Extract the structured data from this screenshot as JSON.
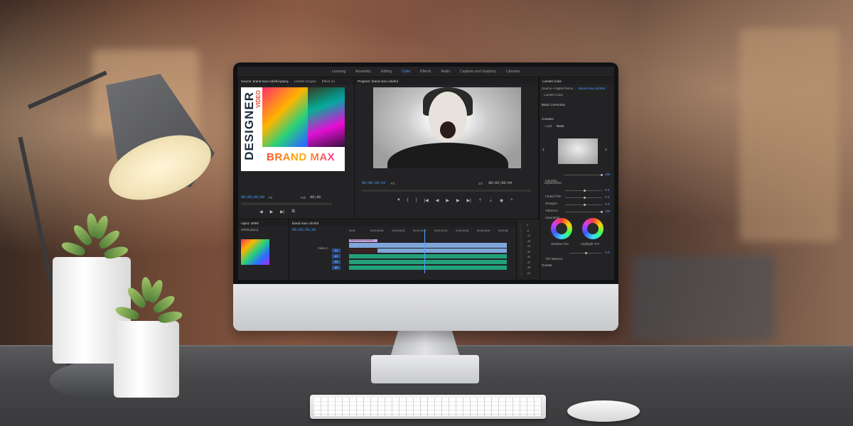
{
  "workspace_tabs": [
    "Learning",
    "Assembly",
    "Editing",
    "Color",
    "Effects",
    "Audio",
    "Captions and Graphics",
    "Libraries"
  ],
  "active_workspace": "Color",
  "source_panel": {
    "tabs": [
      "Source: brand max colorful.prproj",
      "Lumetri Scopes",
      "Effect Co"
    ],
    "poster": {
      "side_text": "DESIGNER",
      "side_small": "VIDEO",
      "title": "BRAND MAX"
    },
    "timecode": "00;00;00;00",
    "fit": "Fit",
    "quality": "Full",
    "timecode_right": "00;00"
  },
  "program_panel": {
    "title": "Program: brand max colorful",
    "timecode": "00;00;28;19",
    "fit": "Fit",
    "scale": "1/2",
    "duration": "00;02;56;04"
  },
  "project_panel": {
    "tabs": [
      "roject: 4efe8",
      "brand max colorful"
    ],
    "file": "4efe8.prproj"
  },
  "timeline": {
    "timecode": "00;00;28;19",
    "ruler": [
      "00;00",
      "00;00;08;00",
      "00;00;16;00",
      "00;00;24;00",
      "00;00;32;00",
      "00;00;40;00",
      "00;00;48;00",
      "00;00;56"
    ],
    "tracks": [
      "V1",
      "A1",
      "A2",
      "A3"
    ],
    "clip_label": "Digital Gems Production",
    "video_label": "Video 1",
    "meter_scale": [
      "0",
      "-6",
      "-12",
      "-18",
      "-24",
      "-30",
      "-36",
      "-42",
      "-48",
      "-54"
    ]
  },
  "lumetri": {
    "title": "Lumetri Color",
    "source": "Source • Digital Gems...",
    "sequence": "brand max colorful",
    "clip": "Lumetri Color",
    "sections": [
      "Basic Correction",
      "Creative",
      "Curves"
    ],
    "look_label": "Look",
    "look_value": "None",
    "intensity_label": "Intensity",
    "intensity_value": "100",
    "adjustments_label": "Adjustments",
    "sliders": [
      {
        "label": "Faded Film",
        "value": "0.0"
      },
      {
        "label": "Sharpen",
        "value": "0.0"
      },
      {
        "label": "Vibrance",
        "value": "0.0"
      },
      {
        "label": "Saturation",
        "value": "100"
      }
    ],
    "wheels": [
      "Shadow Tint",
      "Highlight Tint"
    ],
    "tint_balance_label": "Tint Balance",
    "tint_balance_value": "0.0"
  }
}
